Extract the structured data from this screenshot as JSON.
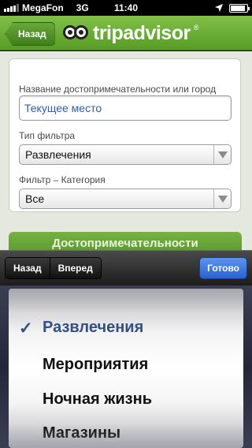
{
  "status_bar": {
    "carrier": "MegaFon",
    "network": "3G",
    "time": "11:40"
  },
  "header": {
    "back_label": "Назад",
    "logo_text": "tripadvisor",
    "logo_mark": "®"
  },
  "form": {
    "location_label": "Название достопримечательности или город",
    "location_value": "Текущее место",
    "filter_type_label": "Тип фильтра",
    "filter_type_value": "Развлечения",
    "filter_category_label": "Фильтр – Категория",
    "filter_category_value": "Все",
    "submit_label": "Достопримечательности"
  },
  "toolbar": {
    "prev_label": "Назад",
    "next_label": "Вперед",
    "done_label": "Готово"
  },
  "picker": {
    "options": [
      "Развлечения",
      "Мероприятия",
      "Ночная жизнь",
      "Магазины"
    ],
    "selected_index": 0,
    "check_mark": "✓"
  },
  "colors": {
    "brand_green": "#589c26",
    "done_blue": "#2a62d0",
    "selected_text": "#324f86"
  }
}
